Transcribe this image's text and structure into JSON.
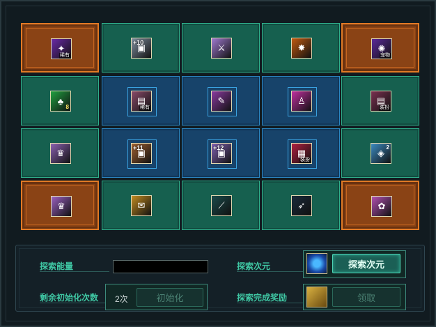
{
  "grid": {
    "rows": [
      [
        {
          "type": "orange",
          "tag": "稀有",
          "color": "#6a2aa8",
          "glyph": "✦"
        },
        {
          "type": "green",
          "level": "+10",
          "color": "#8090a0",
          "glyph": "▣"
        },
        {
          "type": "green",
          "color": "#a07ad0",
          "glyph": "⚔"
        },
        {
          "type": "green",
          "color": "#c05a10",
          "glyph": "✸"
        },
        {
          "type": "orange",
          "tag": "宠物",
          "color": "#5a2a9a",
          "glyph": "✺"
        }
      ],
      [
        {
          "type": "green",
          "qty": "8",
          "color": "#20a040",
          "glyph": "♣"
        },
        {
          "type": "blue",
          "tag": "稀有",
          "color": "#8a4a6a",
          "glyph": "▤"
        },
        {
          "type": "blue",
          "color": "#8a3aa0",
          "glyph": "✎"
        },
        {
          "type": "blue",
          "color": "#c030a0",
          "glyph": "♙"
        },
        {
          "type": "green",
          "tag": "装扮",
          "color": "#7a3050",
          "glyph": "▤"
        }
      ],
      [
        {
          "type": "green",
          "color": "#8a60b0",
          "glyph": "♛"
        },
        {
          "type": "blue",
          "level": "+11",
          "color": "#a06030",
          "glyph": "▣"
        },
        {
          "type": "blue",
          "level": "+12",
          "color": "#8060b0",
          "glyph": "▣"
        },
        {
          "type": "blue",
          "tag": "装扮",
          "color": "#b02040",
          "glyph": "▦"
        },
        {
          "type": "green",
          "qtytop": "2",
          "color": "#3a8ac0",
          "glyph": "◈"
        }
      ],
      [
        {
          "type": "orange",
          "color": "#9a60c0",
          "glyph": "♛"
        },
        {
          "type": "green",
          "color": "#c08a20",
          "glyph": "✉"
        },
        {
          "type": "green",
          "color": "#1a4a4a",
          "glyph": "⟋"
        },
        {
          "type": "green",
          "color": "#1a2a3a",
          "glyph": "➶"
        },
        {
          "type": "orange",
          "color": "#b050b0",
          "glyph": "✿"
        }
      ]
    ]
  },
  "panel": {
    "energy_label": "探索能量",
    "reset_label": "剩余初始化次数",
    "reset_count": "2次",
    "reset_button": "初始化",
    "explore_label": "探索次元",
    "explore_button": "探索次元",
    "reward_label": "探索完成奖励",
    "claim_button": "领取"
  }
}
